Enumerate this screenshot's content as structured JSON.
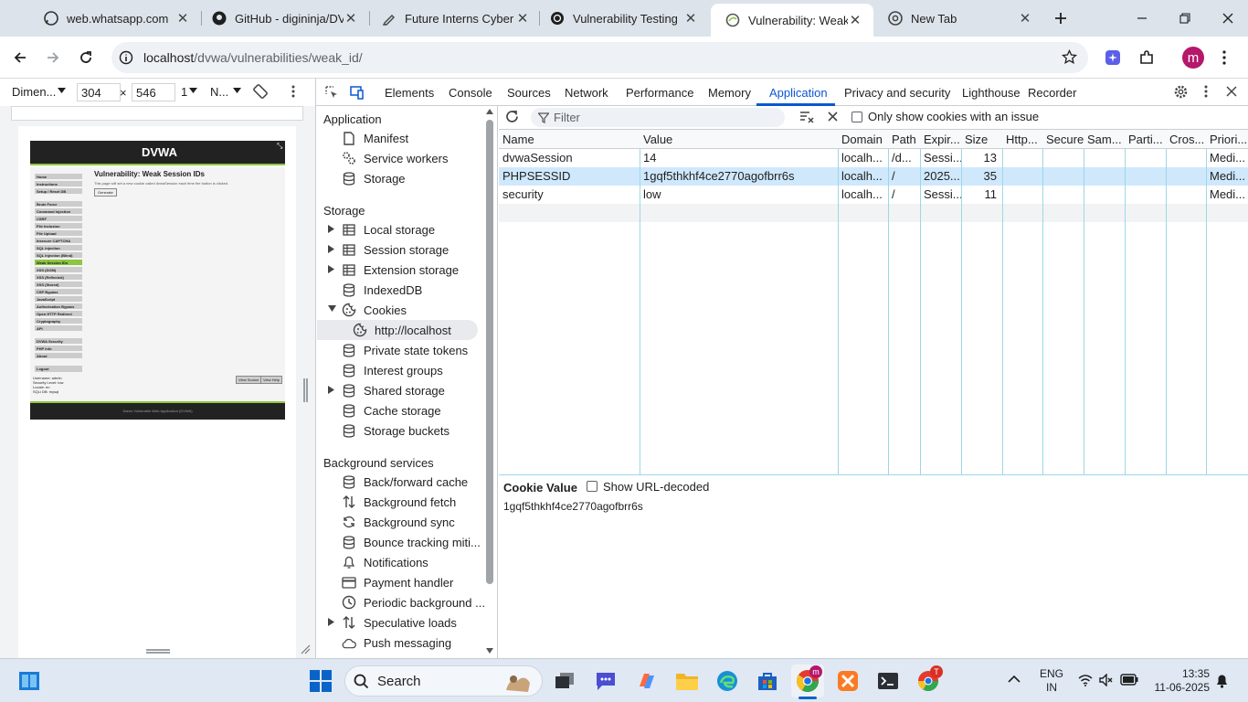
{
  "browser": {
    "tabs": [
      {
        "title": "web.whatsapp.com",
        "icon": "whatsapp-icon"
      },
      {
        "title": "GitHub - digininja/DV",
        "icon": "github-icon"
      },
      {
        "title": "Future Interns Cyber S",
        "icon": "pen-icon"
      },
      {
        "title": "Vulnerability Testing",
        "icon": "chatgpt-icon"
      },
      {
        "title": "Vulnerability: Weak S",
        "icon": "dvwa-icon"
      },
      {
        "title": "New Tab",
        "icon": "chrome-icon"
      }
    ],
    "url_host": "localhost",
    "url_path": "/dvwa/vulnerabilities/weak_id/",
    "profile_initial": "m"
  },
  "device": {
    "dimensions_label": "Dimen...",
    "width": "304",
    "height": "546",
    "times": "×",
    "dpr": "1",
    "throttle": "N..."
  },
  "dvwa": {
    "logo": "DVWA",
    "heading": "Vulnerability: Weak Session IDs",
    "desc": "This page will set a new cookie called dvwaSession each time the button is clicked.",
    "generate": "Generate",
    "menu_top": [
      "Home",
      "Instructions",
      "Setup / Reset DB"
    ],
    "menu_main": [
      "Brute Force",
      "Command Injection",
      "CSRF",
      "File Inclusion",
      "File Upload",
      "Insecure CAPTCHA",
      "SQL Injection",
      "SQL Injection (Blind)",
      "Weak Session IDs",
      "XSS (DOM)",
      "XSS (Reflected)",
      "XSS (Stored)",
      "CSP Bypass",
      "JavaScript",
      "Authorisation Bypass",
      "Open HTTP Redirect",
      "Cryptography",
      "API"
    ],
    "menu_sec": [
      "DVWA Security",
      "PHP Info",
      "About"
    ],
    "logout": "Logout",
    "user": "Username: admin",
    "level": "Security Level: low",
    "locale": "Locale: en",
    "db": "SQLi DB: mysql",
    "view_source": "View Source",
    "view_help": "View Help",
    "footer": "Damn Vulnerable Web Application (DVWA)"
  },
  "devtools": {
    "tabs": [
      "Elements",
      "Console",
      "Sources",
      "Network",
      "Performance",
      "Memory",
      "Application",
      "Privacy and security",
      "Lighthouse",
      "Recorder"
    ],
    "active_tab": "Application"
  },
  "sidebar": {
    "app_header": "Application",
    "app_items": [
      "Manifest",
      "Service workers",
      "Storage"
    ],
    "storage_header": "Storage",
    "storage_items": [
      "Local storage",
      "Session storage",
      "Extension storage",
      "IndexedDB",
      "Cookies",
      "http://localhost",
      "Private state tokens",
      "Interest groups",
      "Shared storage",
      "Cache storage",
      "Storage buckets"
    ],
    "bg_header": "Background services",
    "bg_items": [
      "Back/forward cache",
      "Background fetch",
      "Background sync",
      "Bounce tracking miti...",
      "Notifications",
      "Payment handler",
      "Periodic background ...",
      "Speculative loads",
      "Push messaging"
    ]
  },
  "cookies": {
    "filter_placeholder": "Filter",
    "issue_label": "Only show cookies with an issue",
    "columns": [
      "Name",
      "Value",
      "Domain",
      "Path",
      "Expir...",
      "Size",
      "Http...",
      "Secure",
      "Sam...",
      "Parti...",
      "Cros...",
      "Priori..."
    ],
    "rows": [
      [
        "dvwaSession",
        "14",
        "localh...",
        "/d...",
        "Sessi...",
        "13",
        "",
        "",
        "",
        "",
        "",
        "Medi..."
      ],
      [
        "PHPSESSID",
        "1gqf5thkhf4ce2770agofbrr6s",
        "localh...",
        "/",
        "2025...",
        "35",
        "",
        "",
        "",
        "",
        "",
        "Medi..."
      ],
      [
        "security",
        "low",
        "localh...",
        "/",
        "Sessi...",
        "11",
        "",
        "",
        "",
        "",
        "",
        "Medi..."
      ]
    ],
    "selected_row": 1,
    "value_title": "Cookie Value",
    "show_decoded": "Show URL-decoded",
    "value": "1gqf5thkhf4ce2770agofbrr6s"
  },
  "taskbar": {
    "search": "Search",
    "lang1": "ENG",
    "lang2": "IN",
    "time": "13:35",
    "date": "11-06-2025"
  },
  "colors": {
    "accent": "#0b57d0",
    "selected_row": "#cfe8fc",
    "dvwa_green": "#8dc63f"
  }
}
